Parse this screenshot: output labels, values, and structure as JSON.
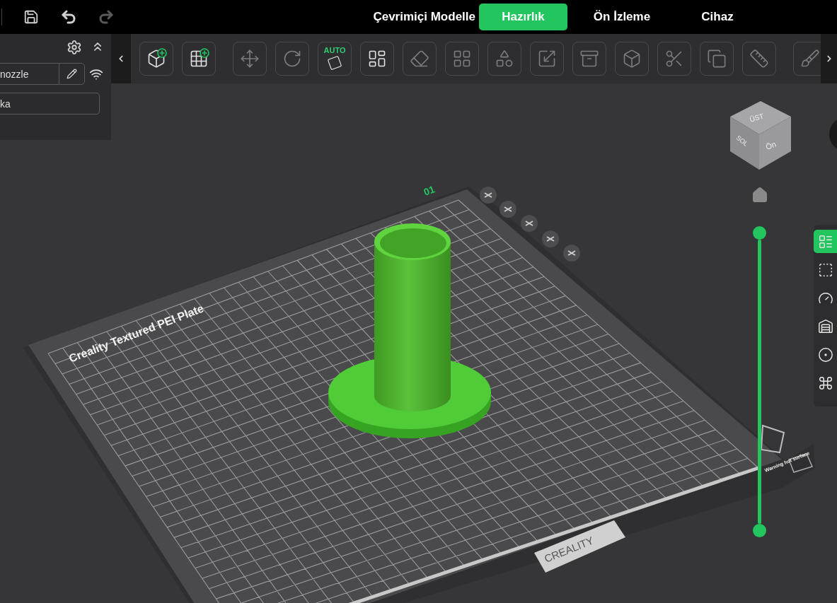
{
  "top_bar": {
    "tabs": [
      {
        "label": "Çevrimiçi Modelle",
        "selected": false
      },
      {
        "label": "Hazırlık",
        "selected": true
      },
      {
        "label": "Ön İzleme",
        "selected": false
      },
      {
        "label": "Cihaz",
        "selected": false
      }
    ]
  },
  "printer_panel": {
    "nozzle_field": {
      "value": "nozzle"
    },
    "filament_field": {
      "value": "ka"
    }
  },
  "toolbar": {
    "groups": [
      {
        "items": [
          {
            "kind": "add-model",
            "disabled": false
          },
          {
            "kind": "add-plate",
            "disabled": false
          }
        ]
      },
      {
        "items": [
          {
            "kind": "move",
            "disabled": true
          },
          {
            "kind": "rotate",
            "disabled": true
          },
          {
            "kind": "auto-orient",
            "label": "AUTO",
            "disabled": false
          },
          {
            "kind": "arrange",
            "disabled": false
          },
          {
            "kind": "lay-flat",
            "disabled": true
          },
          {
            "kind": "split-objects",
            "disabled": true
          },
          {
            "kind": "split-parts",
            "disabled": true
          },
          {
            "kind": "scale",
            "disabled": true
          },
          {
            "kind": "hollow",
            "disabled": true
          },
          {
            "kind": "cube-hole",
            "disabled": true
          },
          {
            "kind": "cut",
            "disabled": true
          },
          {
            "kind": "boolean",
            "disabled": true
          },
          {
            "kind": "measure",
            "disabled": true
          }
        ]
      },
      {
        "items": [
          {
            "kind": "support",
            "disabled": true
          }
        ]
      }
    ]
  },
  "viewport": {
    "plate": {
      "number": "01",
      "name": "Creality Textured PEI Plate",
      "brand": "CREALITY",
      "warning": "Warning hot surface"
    },
    "view_cube": {
      "top": "ÜST",
      "left": "SOL",
      "front": "Ön"
    },
    "layer_slider": {
      "upper": {
        "level": 1
      },
      "lower": {
        "level": 0
      }
    }
  },
  "side_tools": [
    {
      "kind": "object-list",
      "selected": true
    },
    {
      "kind": "region",
      "selected": false
    },
    {
      "kind": "speed",
      "selected": false
    },
    {
      "kind": "support-paint",
      "selected": false
    },
    {
      "kind": "seam",
      "selected": false
    },
    {
      "kind": "fuzzy",
      "selected": false
    }
  ]
}
